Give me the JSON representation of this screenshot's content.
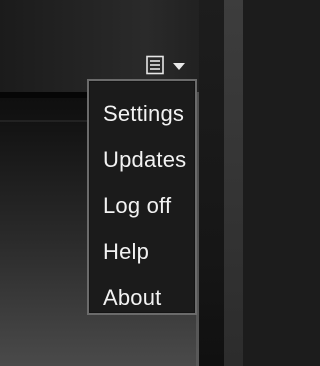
{
  "toolbar": {
    "menu_icon": "hamburger-menu-icon",
    "chevron_icon": "chevron-down-icon"
  },
  "menu": {
    "items": [
      {
        "label": "Settings"
      },
      {
        "label": "Updates"
      },
      {
        "label": "Log off"
      },
      {
        "label": "Help"
      },
      {
        "label": "About"
      }
    ]
  },
  "colors": {
    "menu_background": "#1b1b1b",
    "menu_border": "#6b6b6b",
    "menu_text": "#f2f2f2"
  }
}
